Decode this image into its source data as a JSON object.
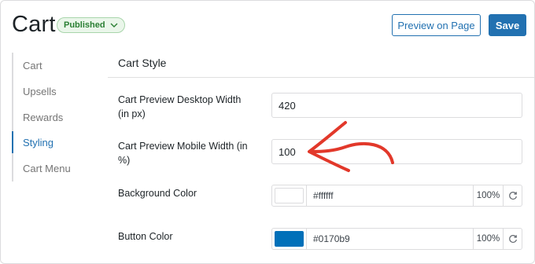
{
  "header": {
    "title": "Cart",
    "status": "Published",
    "preview_label": "Preview on Page",
    "save_label": "Save"
  },
  "sidebar": {
    "items": [
      {
        "label": "Cart"
      },
      {
        "label": "Upsells"
      },
      {
        "label": "Rewards"
      },
      {
        "label": "Styling",
        "active": true
      },
      {
        "label": "Cart Menu"
      }
    ]
  },
  "section": {
    "title": "Cart Style",
    "fields": {
      "desktop_width": {
        "label": "Cart Preview Desktop Width (in px)",
        "value": "420"
      },
      "mobile_width": {
        "label": "Cart Preview Mobile Width (in %)",
        "value": "100"
      },
      "background_color": {
        "label": "Background Color",
        "hex": "#ffffff",
        "opacity": "100%"
      },
      "button_color": {
        "label": "Button Color",
        "hex": "#0170b9",
        "opacity": "100%"
      }
    }
  },
  "colors": {
    "accent": "#2271b1",
    "badge_text": "#2a7f33",
    "badge_bg": "#eaf6ea",
    "arrow": "#e2382a"
  }
}
